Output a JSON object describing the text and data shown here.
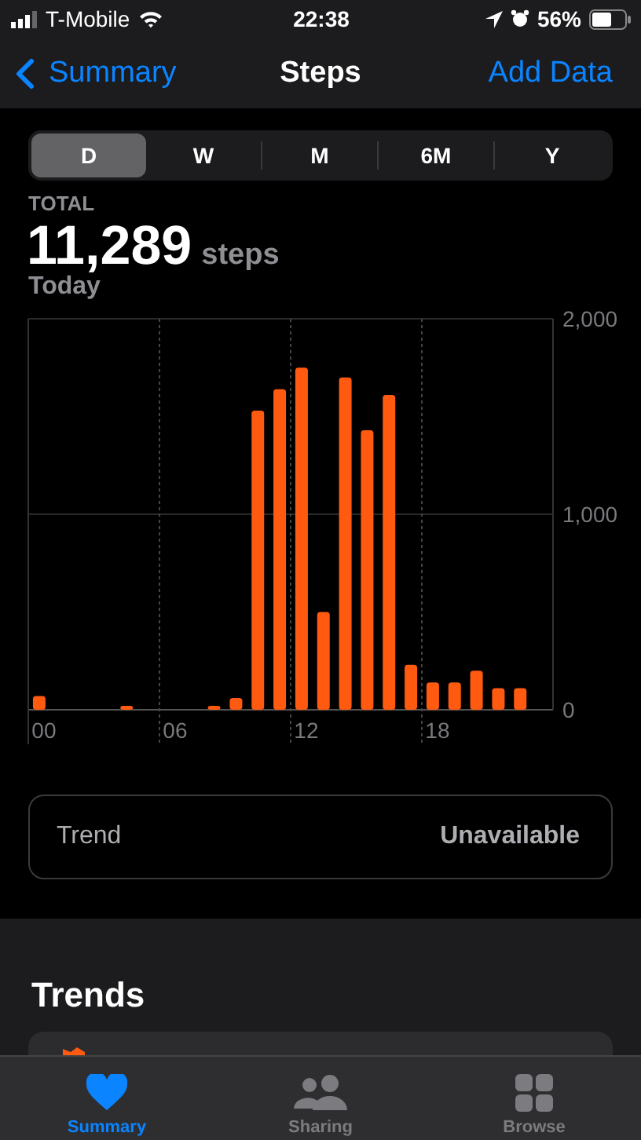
{
  "status_bar": {
    "carrier": "T-Mobile",
    "time": "22:38",
    "battery": "56%"
  },
  "nav": {
    "back": "Summary",
    "title": "Steps",
    "action": "Add Data"
  },
  "segments": [
    {
      "label": "D",
      "selected": true
    },
    {
      "label": "W",
      "selected": false
    },
    {
      "label": "M",
      "selected": false
    },
    {
      "label": "6M",
      "selected": false
    },
    {
      "label": "Y",
      "selected": false
    }
  ],
  "summary": {
    "label": "TOTAL",
    "value": "11,289",
    "unit": "steps",
    "period": "Today"
  },
  "chart_data": {
    "type": "bar",
    "x": [
      0,
      1,
      2,
      3,
      4,
      5,
      6,
      7,
      8,
      9,
      10,
      11,
      12,
      13,
      14,
      15,
      16,
      17,
      18,
      19,
      20,
      21,
      22,
      23
    ],
    "series": [
      {
        "color": "#ff5a10",
        "values": [
          70,
          0,
          0,
          0,
          20,
          0,
          0,
          0,
          20,
          60,
          1530,
          1640,
          1750,
          500,
          1700,
          1430,
          1610,
          230,
          140,
          140,
          200,
          110,
          110,
          0
        ]
      }
    ],
    "xlim": [
      -0.5,
      23.5
    ],
    "ylim": [
      0,
      2000
    ],
    "yticks": [
      {
        "value": 0,
        "label": "0"
      },
      {
        "value": 1000,
        "label": "1,000"
      },
      {
        "value": 2000,
        "label": "2,000"
      }
    ],
    "xticks": [
      {
        "value": 0,
        "label": "00"
      },
      {
        "value": 6,
        "label": "06"
      },
      {
        "value": 12,
        "label": "12"
      },
      {
        "value": 18,
        "label": "18"
      }
    ]
  },
  "trend_row": {
    "label": "Trend",
    "value": "Unavailable"
  },
  "section_title": "Trends",
  "tab_bar": [
    {
      "kind": "heart",
      "label": "Summary",
      "selected": true
    },
    {
      "kind": "people",
      "label": "Sharing",
      "selected": false
    },
    {
      "kind": "grid",
      "label": "Browse",
      "selected": false
    }
  ]
}
